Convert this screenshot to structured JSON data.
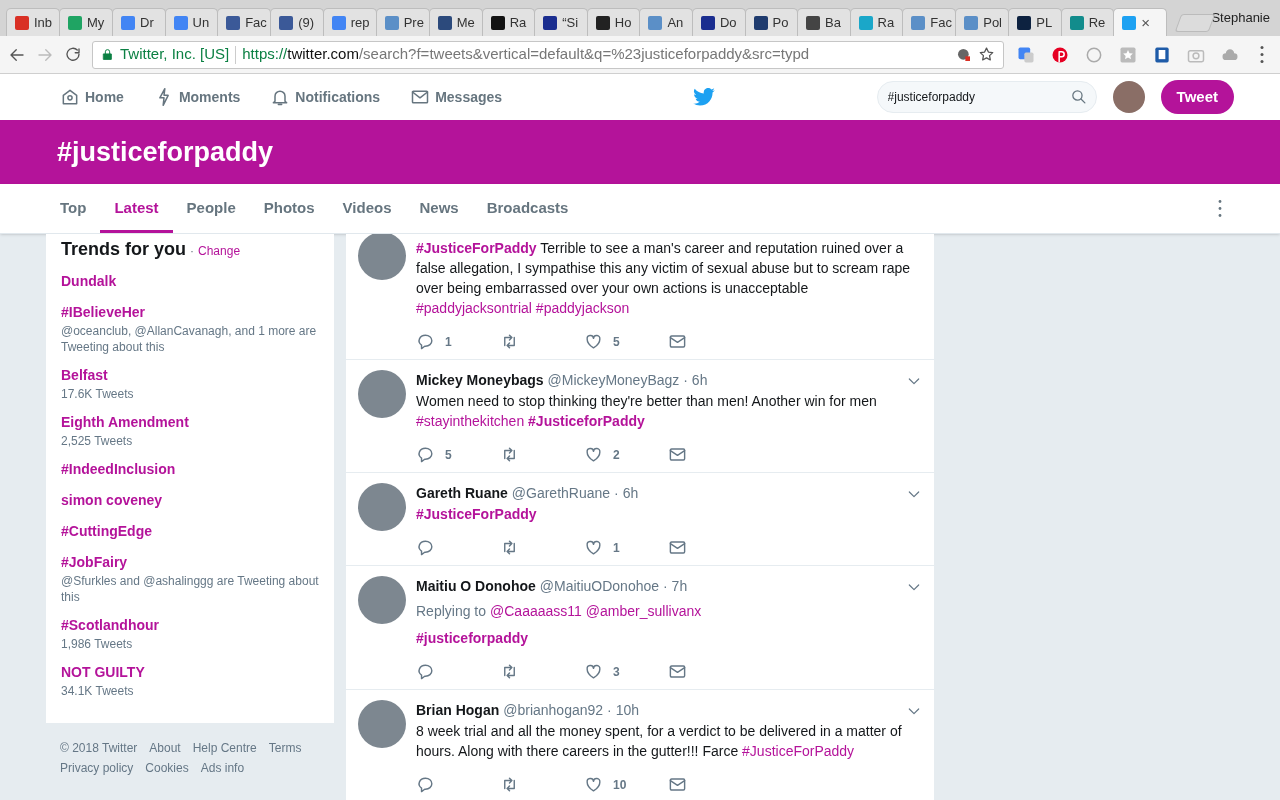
{
  "browser": {
    "tabs": [
      {
        "title": "Inb",
        "color": "#d93025",
        "selected": false
      },
      {
        "title": "My",
        "color": "#1fa463",
        "selected": false
      },
      {
        "title": "Dr",
        "color": "#4285f4",
        "selected": false
      },
      {
        "title": "Un",
        "color": "#4285f4",
        "selected": false
      },
      {
        "title": "Fac",
        "color": "#3b5998",
        "selected": false
      },
      {
        "title": "(9)",
        "color": "#3b5998",
        "selected": false
      },
      {
        "title": "rep",
        "color": "#4285f4",
        "selected": false
      },
      {
        "title": "Pre",
        "color": "#5b8fc7",
        "selected": false
      },
      {
        "title": "Me",
        "color": "#2c4a7c",
        "selected": false
      },
      {
        "title": "Ra",
        "color": "#111111",
        "selected": false
      },
      {
        "title": "“Si",
        "color": "#1a2d8f",
        "selected": false
      },
      {
        "title": "Ho",
        "color": "#222222",
        "selected": false
      },
      {
        "title": "An",
        "color": "#5b8fc7",
        "selected": false
      },
      {
        "title": "Do",
        "color": "#1a2d8f",
        "selected": false
      },
      {
        "title": "Po",
        "color": "#1f3b6e",
        "selected": false
      },
      {
        "title": "Ba",
        "color": "#444444",
        "selected": false
      },
      {
        "title": "Ra",
        "color": "#1aa7c9",
        "selected": false
      },
      {
        "title": "Fac",
        "color": "#5b8fc7",
        "selected": false
      },
      {
        "title": "Pol",
        "color": "#5b8fc7",
        "selected": false
      },
      {
        "title": "PL",
        "color": "#0d2240",
        "selected": false
      },
      {
        "title": "Re",
        "color": "#128c8c",
        "selected": false
      },
      {
        "color": "#1da1f2",
        "selected": true
      }
    ],
    "close_glyph": "×",
    "profile": "Stephanie",
    "address": {
      "org": "Twitter, Inc. [US]",
      "scheme": "https://",
      "host": "twitter.com",
      "path": "/search?f=tweets&vertical=default&q=%23justiceforpaddy&src=typd"
    }
  },
  "nav": {
    "items": [
      {
        "label": "Home",
        "kind": "home"
      },
      {
        "label": "Moments",
        "kind": "moments"
      },
      {
        "label": "Notifications",
        "kind": "notifications"
      },
      {
        "label": "Messages",
        "kind": "messages"
      }
    ],
    "search": {
      "value": "#justiceforpaddy"
    },
    "tweet_button": "Tweet"
  },
  "banner": {
    "title": "#justiceforpaddy"
  },
  "search_tabs": [
    {
      "label": "Top",
      "selected": false
    },
    {
      "label": "Latest",
      "selected": true
    },
    {
      "label": "People",
      "selected": false
    },
    {
      "label": "Photos",
      "selected": false
    },
    {
      "label": "Videos",
      "selected": false
    },
    {
      "label": "News",
      "selected": false
    },
    {
      "label": "Broadcasts",
      "selected": false
    }
  ],
  "trends": {
    "title": "Trends for you",
    "separator": "·",
    "change": "Change",
    "items": [
      {
        "name": "Dundalk"
      },
      {
        "name": "#IBelieveHer",
        "meta": "@oceanclub, @AllanCavanagh, and 1 more are Tweeting about this"
      },
      {
        "name": "Belfast",
        "meta": "17.6K Tweets"
      },
      {
        "name": "Eighth Amendment",
        "meta": "2,525 Tweets"
      },
      {
        "name": "#IndeedInclusion"
      },
      {
        "name": "simon coveney"
      },
      {
        "name": "#CuttingEdge"
      },
      {
        "name": "#JobFairy",
        "meta": "@Sfurkles and @ashalinggg are Tweeting about this"
      },
      {
        "name": "#Scotlandhour",
        "meta": "1,986 Tweets"
      },
      {
        "name": "NOT GUILTY",
        "meta": "34.1K Tweets"
      }
    ]
  },
  "footer_links": [
    "© 2018 Twitter",
    "About",
    "Help Centre",
    "Terms",
    "Privacy policy",
    "Cookies",
    "Ads info"
  ],
  "tweets": [
    {
      "body": [
        {
          "kind": "tag_bold",
          "text": "#JusticeForPaddy"
        },
        {
          "kind": "plain",
          "text": " Terrible to see a man's career and reputation ruined over a false allegation, I sympathise this any victim of sexual abuse but to scream rape over being embarrassed over your own actions is unacceptable "
        },
        {
          "kind": "tag",
          "text": "#paddyjacksontrial"
        },
        {
          "kind": "tag",
          "text": "#paddyjackson"
        }
      ],
      "replies": "1",
      "likes": "5"
    },
    {
      "name": "Mickey Moneybags",
      "handle": "@MickeyMoneyBagz",
      "time": "· 6h",
      "body": [
        {
          "kind": "plain",
          "text": "Women need to stop thinking they're better than men! Another win for men "
        },
        {
          "kind": "tag",
          "text": "#stayinthekitchen"
        },
        {
          "kind": "tag_bold",
          "text": "#JusticeforPaddy"
        }
      ],
      "replies": "5",
      "likes": "2"
    },
    {
      "name": "Gareth Ruane",
      "handle": "@GarethRuane",
      "time": "· 6h",
      "body": [
        {
          "kind": "tag_bold",
          "text": "#JusticeForPaddy"
        }
      ],
      "likes": "1"
    },
    {
      "name": "Maitiu O Donohoe",
      "handle": "@MaitiuODonohoe",
      "time": "· 7h",
      "reply_to": {
        "label": "Replying to",
        "mentions": [
          "@Caaaaass11",
          "@amber_sullivanx"
        ]
      },
      "body": [
        {
          "kind": "tag_bold",
          "text": "#justiceforpaddy"
        }
      ],
      "likes": "3"
    },
    {
      "name": "Brian Hogan",
      "handle": "@brianhogan92",
      "time": "· 10h",
      "body": [
        {
          "kind": "plain",
          "text": "8 week trial and all the money spent, for a verdict to be delivered in a matter of hours. Along with there careers in the gutter!!! Farce "
        },
        {
          "kind": "tag",
          "text": "#JusticeForPaddy"
        }
      ],
      "likes": "10"
    }
  ]
}
